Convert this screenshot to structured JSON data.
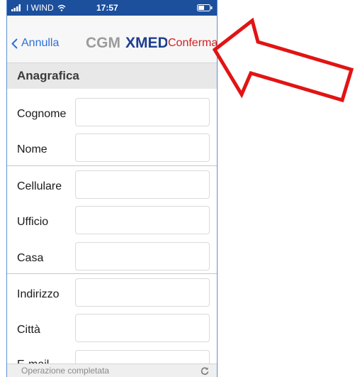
{
  "status_bar": {
    "carrier": "I WIND",
    "time": "17:57",
    "icons": [
      "signal-icon",
      "wifi-icon",
      "battery-icon"
    ]
  },
  "nav": {
    "back_label": "Annulla",
    "logo_cgm": "CGM",
    "logo_xmedical": "XMEDICAL",
    "confirm_label": "Conferma",
    "back_icon": "chevron-left-icon"
  },
  "section": {
    "title": "Anagrafica"
  },
  "fields": [
    {
      "label": "Cognome",
      "value": ""
    },
    {
      "label": "Nome",
      "value": ""
    },
    {
      "label": "Cellulare",
      "value": ""
    },
    {
      "label": "Ufficio",
      "value": ""
    },
    {
      "label": "Casa",
      "value": ""
    },
    {
      "label": "Indirizzo",
      "value": ""
    },
    {
      "label": "Città",
      "value": ""
    },
    {
      "label": "E-mail",
      "value": ""
    }
  ],
  "toast": {
    "text": "Operazione completata",
    "icon": "refresh-icon"
  },
  "colors": {
    "status_bar": "#1c4f9c",
    "link_blue": "#2f6fd8",
    "confirm_red": "#d21e1e",
    "logo_grey": "#9b9b9b",
    "logo_navy": "#1f3f8f",
    "annotation_arrow": "#e11414"
  },
  "annotation": {
    "icon": "red-arrow-icon"
  }
}
